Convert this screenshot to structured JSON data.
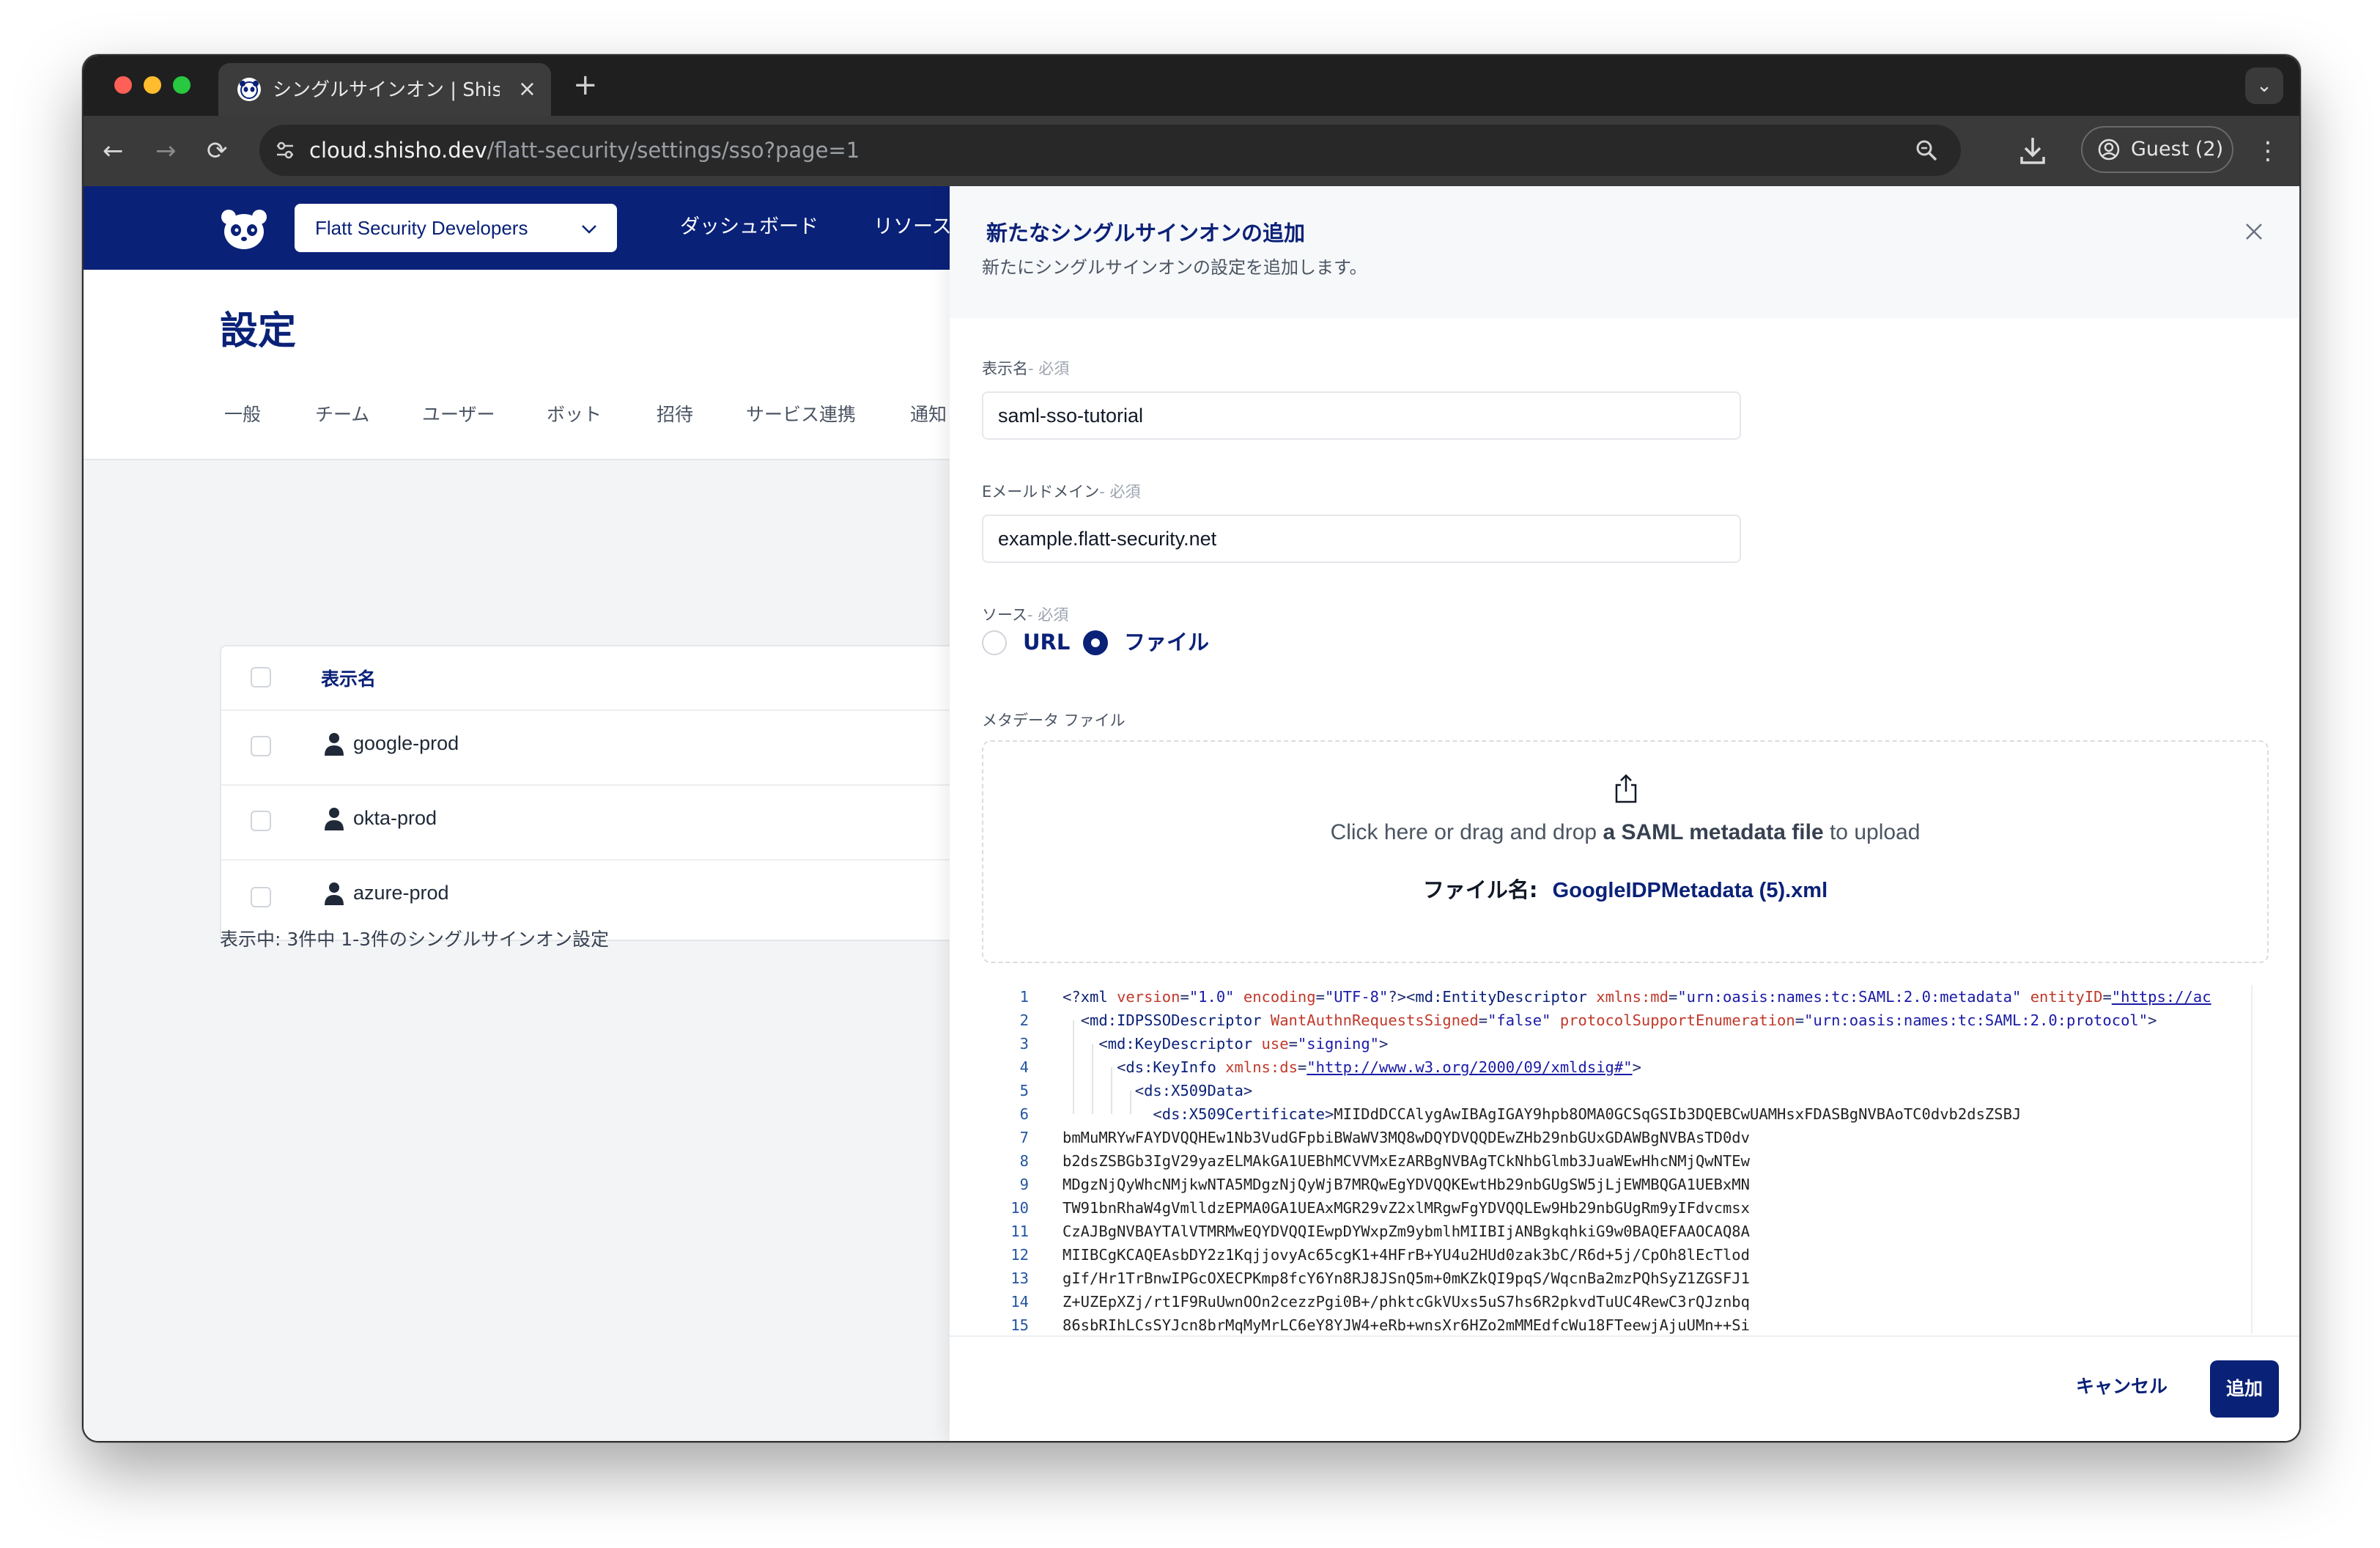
{
  "browser": {
    "tab_title": "シングルサインオン | Shisho Cl",
    "url_host": "cloud.shisho.dev",
    "url_path": "/flatt-security/settings/sso?page=1",
    "profile_label": "Guest (2)"
  },
  "app": {
    "org_selector": "Flatt Security Developers",
    "nav": [
      "ダッシュボード",
      "リソース"
    ],
    "page_title": "設定",
    "settings_tabs": [
      "一般",
      "チーム",
      "ユーザー",
      "ボット",
      "招待",
      "サービス連携",
      "通知"
    ],
    "table": {
      "column_header": "表示名",
      "rows": [
        "google-prod",
        "okta-prod",
        "azure-prod"
      ]
    },
    "footer_text": "表示中: 3件中 1-3件のシングルサインオン設定"
  },
  "drawer": {
    "title": "新たなシングルサインオンの追加",
    "subtitle": "新たにシングルサインオンの設定を追加します。",
    "display_name": {
      "label": "表示名",
      "required": "- 必須",
      "value": "saml-sso-tutorial"
    },
    "email_domain": {
      "label": "Eメールドメイン",
      "required": "- 必須",
      "value": "example.flatt-security.net"
    },
    "source": {
      "label": "ソース",
      "required": "- 必須",
      "options": [
        "URL",
        "ファイル"
      ],
      "selected": "ファイル"
    },
    "metadata_label": "メタデータ ファイル",
    "upload": {
      "prefix": "Click here or drag and drop ",
      "emphasis": "a SAML metadata file",
      "suffix": " to upload",
      "file_label": "ファイル名:",
      "file_name": "GoogleIDPMetadata (5).xml"
    },
    "cancel_label": "キャンセル",
    "add_label": "追加"
  },
  "code": {
    "line_numbers": [
      "1",
      "2",
      "3",
      "4",
      "5",
      "6",
      "7",
      "8",
      "9",
      "10",
      "11",
      "12",
      "13",
      "14",
      "15"
    ],
    "line1": {
      "open": "<?",
      "tag": "xml",
      "a1": "version",
      "v1": "\"1.0\"",
      "a2": "encoding",
      "v2": "\"UTF-8\"",
      "mid": "?><",
      "tag2": "md:EntityDescriptor",
      "a3": "xmlns:md",
      "v3": "\"urn:oasis:names:tc:SAML:2.0:metadata\"",
      "a4": "entityID",
      "v4": "\"https://ac"
    },
    "line2": {
      "tag": "md:IDPSSODescriptor",
      "a1": "WantAuthnRequestsSigned",
      "v1": "\"false\"",
      "a2": "protocolSupportEnumeration",
      "v2": "\"urn:oasis:names:tc:SAML:2.0:protocol\""
    },
    "line3": {
      "tag": "md:KeyDescriptor",
      "a1": "use",
      "v1": "\"signing\""
    },
    "line4": {
      "tag": "ds:KeyInfo",
      "a1": "xmlns:ds",
      "v1": "\"http://www.w3.org/2000/09/xmldsig#\""
    },
    "line5": {
      "tag": "ds:X509Data"
    },
    "line6": {
      "tag": "ds:X509Certificate",
      "text": "MIIDdDCCAlygAwIBAgIGAY9hpb8OMA0GCSqGSIb3DQEBCwUAMHsxFDASBgNVBAoTC0dvb2dsZSBJ"
    },
    "cert_lines": [
      "bmMuMRYwFAYDVQQHEw1Nb3VudGFpbiBWaWV3MQ8wDQYDVQQDEwZHb29nbGUxGDAWBgNVBAsTD0dv",
      "b2dsZSBGb3IgV29yazELMAkGA1UEBhMCVVMxEzARBgNVBAgTCkNhbGlmb3JuaWEwHhcNMjQwNTEw",
      "MDgzNjQyWhcNMjkwNTA5MDgzNjQyWjB7MRQwEgYDVQQKEwtHb29nbGUgSW5jLjEWMBQGA1UEBxMN",
      "TW91bnRhaW4gVmlldzEPMA0GA1UEAxMGR29vZ2xlMRgwFgYDVQQLEw9Hb29nbGUgRm9yIFdvcmsx",
      "CzAJBgNVBAYTAlVTMRMwEQYDVQQIEwpDYWxpZm9ybmlhMIIBIjANBgkqhkiG9w0BAQEFAAOCAQ8A",
      "MIIBCgKCAQEAsbDY2z1KqjjovyAc65cgK1+4HFrB+YU4u2HUd0zak3bC/R6d+5j/CpOh8lEcTlod",
      "gIf/Hr1TrBnwIPGcOXECPKmp8fcY6Yn8RJ8JSnQ5m+0mKZkQI9pqS/WqcnBa2mzPQhSyZ1ZGSFJ1",
      "Z+UZEpXZj/rt1F9RuUwnOOn2cezzPgi0B+/phktcGkVUxs5uS7hs6R2pkvdTuUC4RewC3rQJznbq",
      "86sbRIhLCsSYJcn8brMqMyMrLC6eY8YJW4+eRb+wnsXr6HZo2mMMEdfcWu18FTeewjAjuUMn++Si"
    ]
  }
}
